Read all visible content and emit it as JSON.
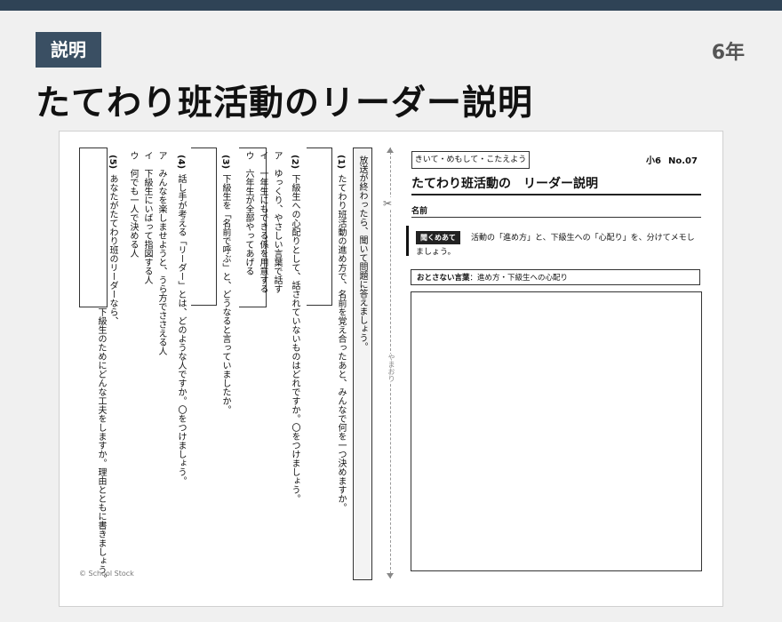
{
  "badge": "説明",
  "grade": "6年",
  "title": "たてわり班活動のリーダー説明",
  "sheet": {
    "instruction": "放送が終わったら、聞いて問題に答えましょう。",
    "q1": {
      "label": "(1)",
      "question": "たてわり班活動の進め方で、名前を覚え合ったあと、みんなで何を一つ決めますか。"
    },
    "q2": {
      "label": "(2)",
      "question": "下級生への心配りとして、話されていないものはどれですか。〇をつけましょう。",
      "options": [
        {
          "mark": "ア",
          "text": "ゆっくり、やさしい言葉で話す"
        },
        {
          "mark": "イ",
          "text": "一年生にもできる係を用意する"
        },
        {
          "mark": "ウ",
          "text": "六年生が全部やってあげる"
        }
      ]
    },
    "q3": {
      "label": "(3)",
      "question": "下級生を「名前で呼ぶ」と、どうなると言っていましたか。"
    },
    "q4": {
      "label": "(4)",
      "question": "話し手が考える「リーダー」とは、どのような人ですか。〇をつけましょう。",
      "options": [
        {
          "mark": "ア",
          "text": "みんなを楽しませようと、うら方でささえる人"
        },
        {
          "mark": "イ",
          "text": "下級生にいばって指図する人"
        },
        {
          "mark": "ウ",
          "text": "何でも一人で決める人"
        }
      ]
    },
    "q5": {
      "label": "(5)",
      "question_a": "あなたがたてわり班のリーダーなら、",
      "question_b": "下級生のためにどんな工夫をしますか。理由とともに書きましょう。"
    },
    "copyright": "© School Stock",
    "fold_label": "やまおり",
    "scissors": "✂",
    "header_tag": "きいて・めもして・こたえよう",
    "grade_small": "小6",
    "number": "No.07",
    "worksheet_title": "たてわり班活動の　リーダー説明",
    "name_label": "名前",
    "listen_tag": "聞くめあて",
    "listen_text": "活動の「進め方」と、下級生への「心配り」を、分けてメモし",
    "listen_text2": "ましょう。",
    "keywords_label": "おとさない言葉",
    "keywords_text": "：進め方・下級生への心配り"
  }
}
